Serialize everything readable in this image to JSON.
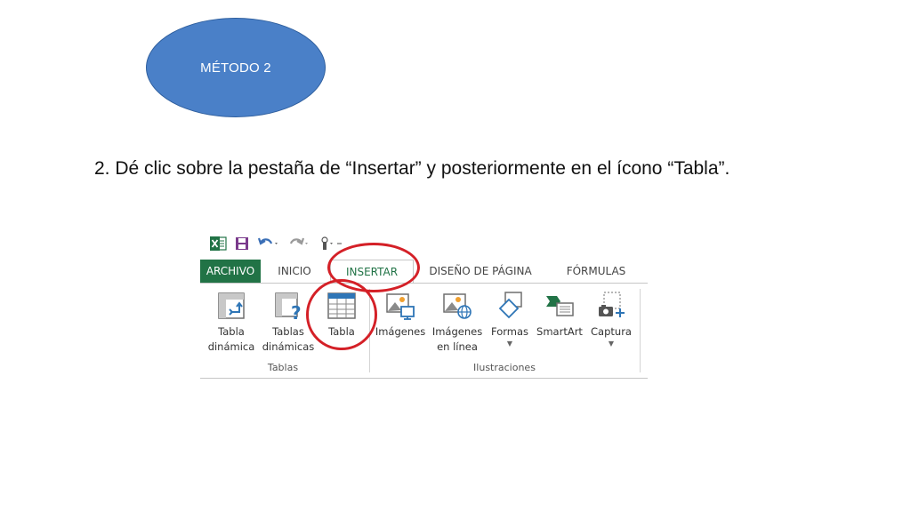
{
  "slide": {
    "oval_label": "MÉTODO 2",
    "instruction": "2. Dé clic sobre la pestaña de “Insertar” y posteriormente en el ícono “Tabla”."
  },
  "ribbon": {
    "tabs": {
      "archivo": "ARCHIVO",
      "inicio": "INICIO",
      "insertar": "INSERTAR",
      "diseno": "DISEÑO DE PÁGINA",
      "formulas": "FÓRMULAS"
    },
    "buttons": {
      "tabla_dinamica_1": "Tabla",
      "tabla_dinamica_2": "dinámica",
      "tablas_din_1": "Tablas",
      "tablas_din_2": "dinámicas",
      "tabla": "Tabla",
      "imagenes": "Imágenes",
      "imagenes_linea_1": "Imágenes",
      "imagenes_linea_2": "en línea",
      "formas": "Formas",
      "smartart": "SmartArt",
      "captura": "Captura"
    },
    "groups": {
      "tablas": "Tablas",
      "ilustraciones": "Ilustraciones"
    }
  },
  "colors": {
    "oval_fill": "#4a80c8",
    "excel_green": "#217346",
    "highlight_red": "#d42027"
  },
  "icons": [
    "excel-icon",
    "save-icon",
    "undo-icon",
    "redo-icon",
    "touch-mode-icon"
  ]
}
